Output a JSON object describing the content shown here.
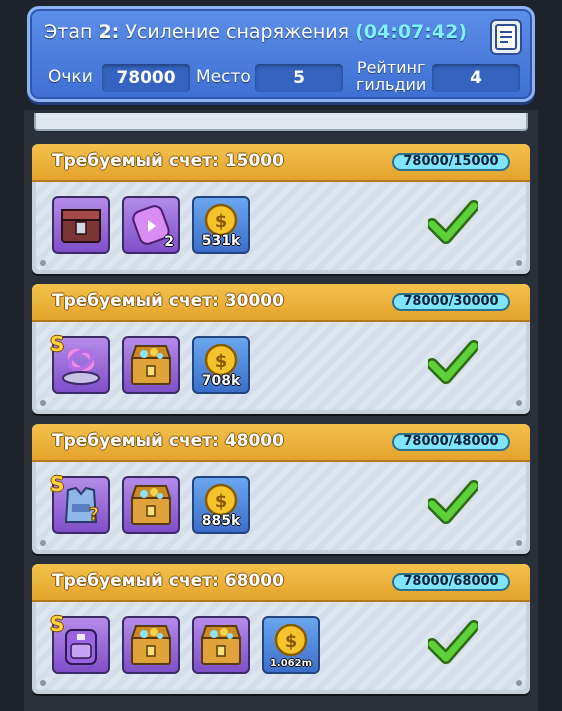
{
  "header": {
    "stage_prefix": "Этап",
    "stage_number": "2:",
    "stage_name": "Усиление снаряжения",
    "timer_open": "(",
    "timer": "04:07:42",
    "timer_close": ")",
    "points_label": "Очки",
    "points_value": "78000",
    "place_label": "Место",
    "place_value": "5",
    "rating_label_line1": "Рейтинг",
    "rating_label_line2": "гильдии",
    "rating_value": "4"
  },
  "colors": {
    "header_blue": "#4a7bdc",
    "card_header_gold": "#eab23a",
    "check_green": "#5ed13a",
    "progress_cyan": "#7fe5ff"
  },
  "tiers": [
    {
      "label": "Требуемый счет:",
      "required": "15000",
      "progress": "78000/15000",
      "completed": true,
      "rewards": [
        {
          "icon": "equipment-chest-icon",
          "amount": ""
        },
        {
          "icon": "purple-scroll-icon",
          "amount": "2"
        },
        {
          "icon": "gold-coin-icon",
          "amount": "531k"
        }
      ]
    },
    {
      "label": "Требуемый счет:",
      "required": "30000",
      "progress": "78000/30000",
      "completed": true,
      "rewards": [
        {
          "icon": "s-rank-relic-icon",
          "amount": "",
          "badge": "S"
        },
        {
          "icon": "treasure-chest-icon",
          "amount": ""
        },
        {
          "icon": "gold-coin-icon",
          "amount": "708k"
        }
      ]
    },
    {
      "label": "Требуемый счет:",
      "required": "48000",
      "progress": "78000/48000",
      "completed": true,
      "rewards": [
        {
          "icon": "s-rank-mystery-armor-icon",
          "amount": "",
          "badge": "S"
        },
        {
          "icon": "treasure-chest-icon",
          "amount": ""
        },
        {
          "icon": "gold-coin-icon",
          "amount": "885k"
        }
      ]
    },
    {
      "label": "Требуемый счет:",
      "required": "68000",
      "progress": "78000/68000",
      "completed": true,
      "rewards": [
        {
          "icon": "s-rank-backpack-icon",
          "amount": "",
          "badge": "S"
        },
        {
          "icon": "treasure-chest-icon",
          "amount": ""
        },
        {
          "icon": "treasure-chest-icon",
          "amount": ""
        },
        {
          "icon": "gold-coin-icon",
          "amount": "1.062m"
        }
      ]
    }
  ]
}
